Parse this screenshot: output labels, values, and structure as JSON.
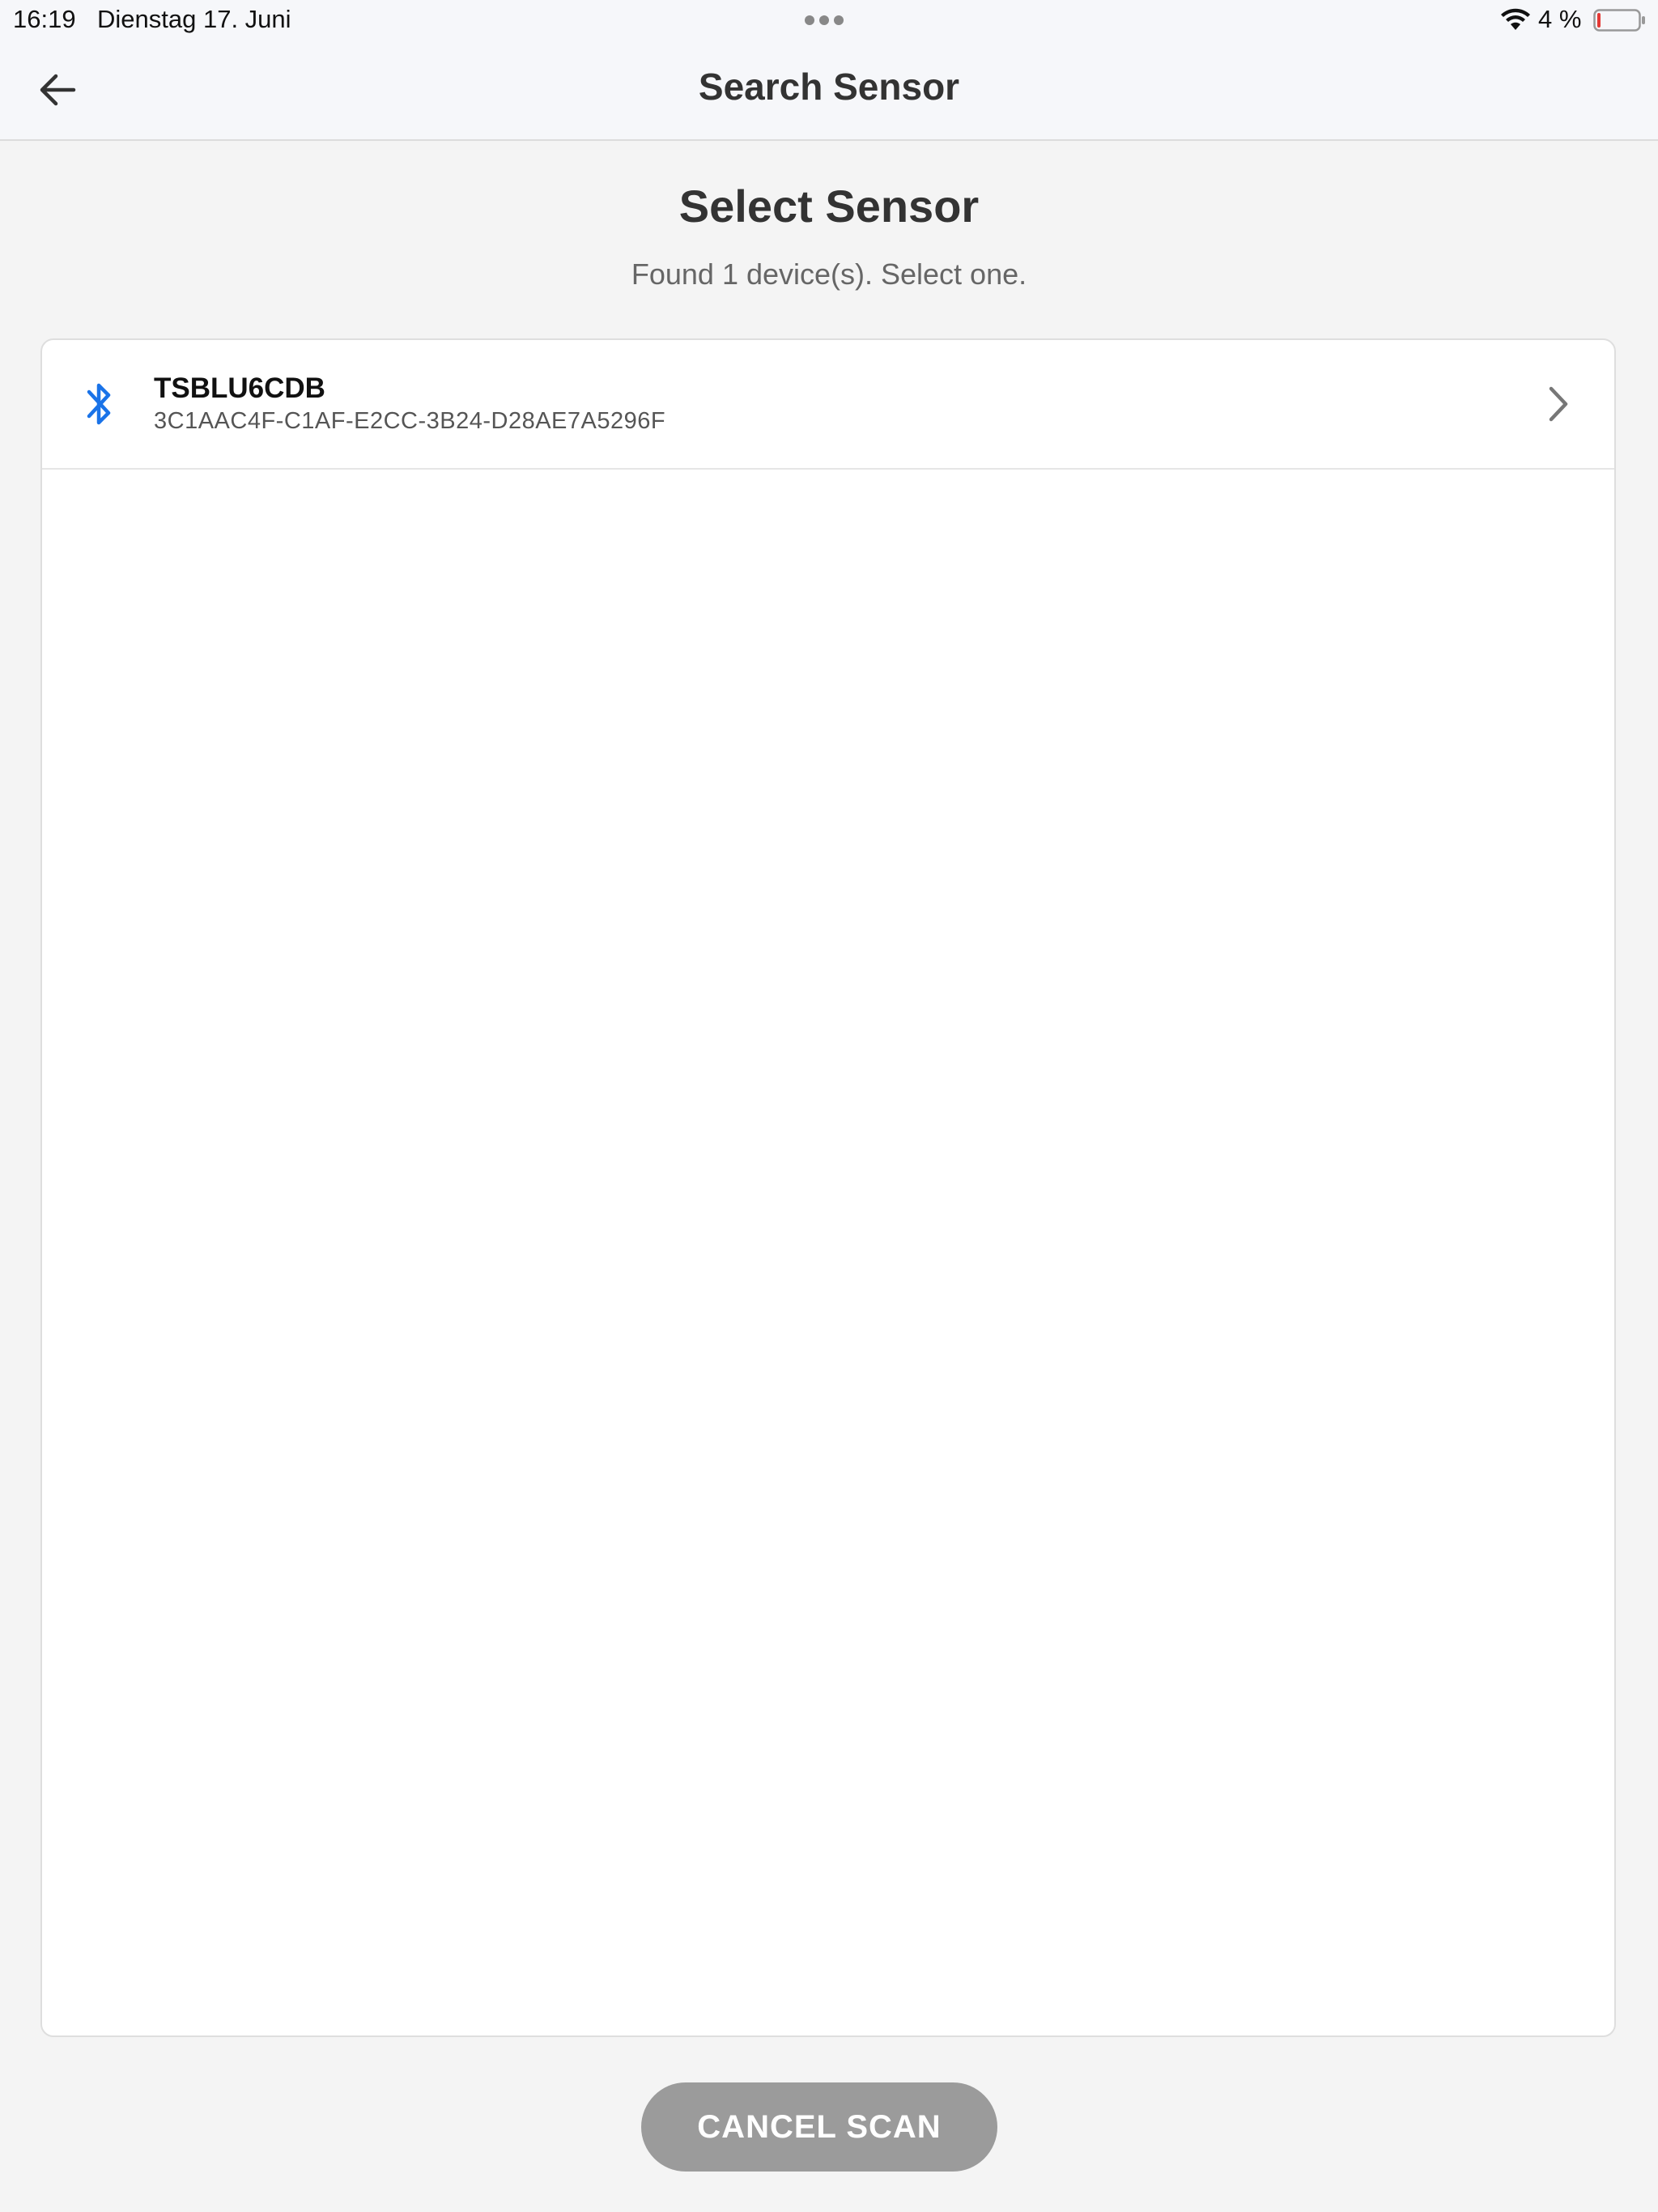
{
  "status_bar": {
    "time": "16:19",
    "date": "Dienstag 17. Juni",
    "battery_percent": "4 %"
  },
  "nav": {
    "title": "Search Sensor",
    "back_icon": "arrow-left-icon"
  },
  "main": {
    "heading": "Select Sensor",
    "subheading": "Found 1 device(s). Select one."
  },
  "devices": [
    {
      "name": "TSBLU6CDB",
      "id": "3C1AAC4F-C1AF-E2CC-3B24-D28AE7A5296F",
      "icon": "bluetooth-icon"
    }
  ],
  "actions": {
    "cancel_label": "CANCEL SCAN"
  },
  "colors": {
    "accent_blue": "#1a73e8",
    "button_gray": "#9b9b9b",
    "background": "#f4f4f4"
  }
}
